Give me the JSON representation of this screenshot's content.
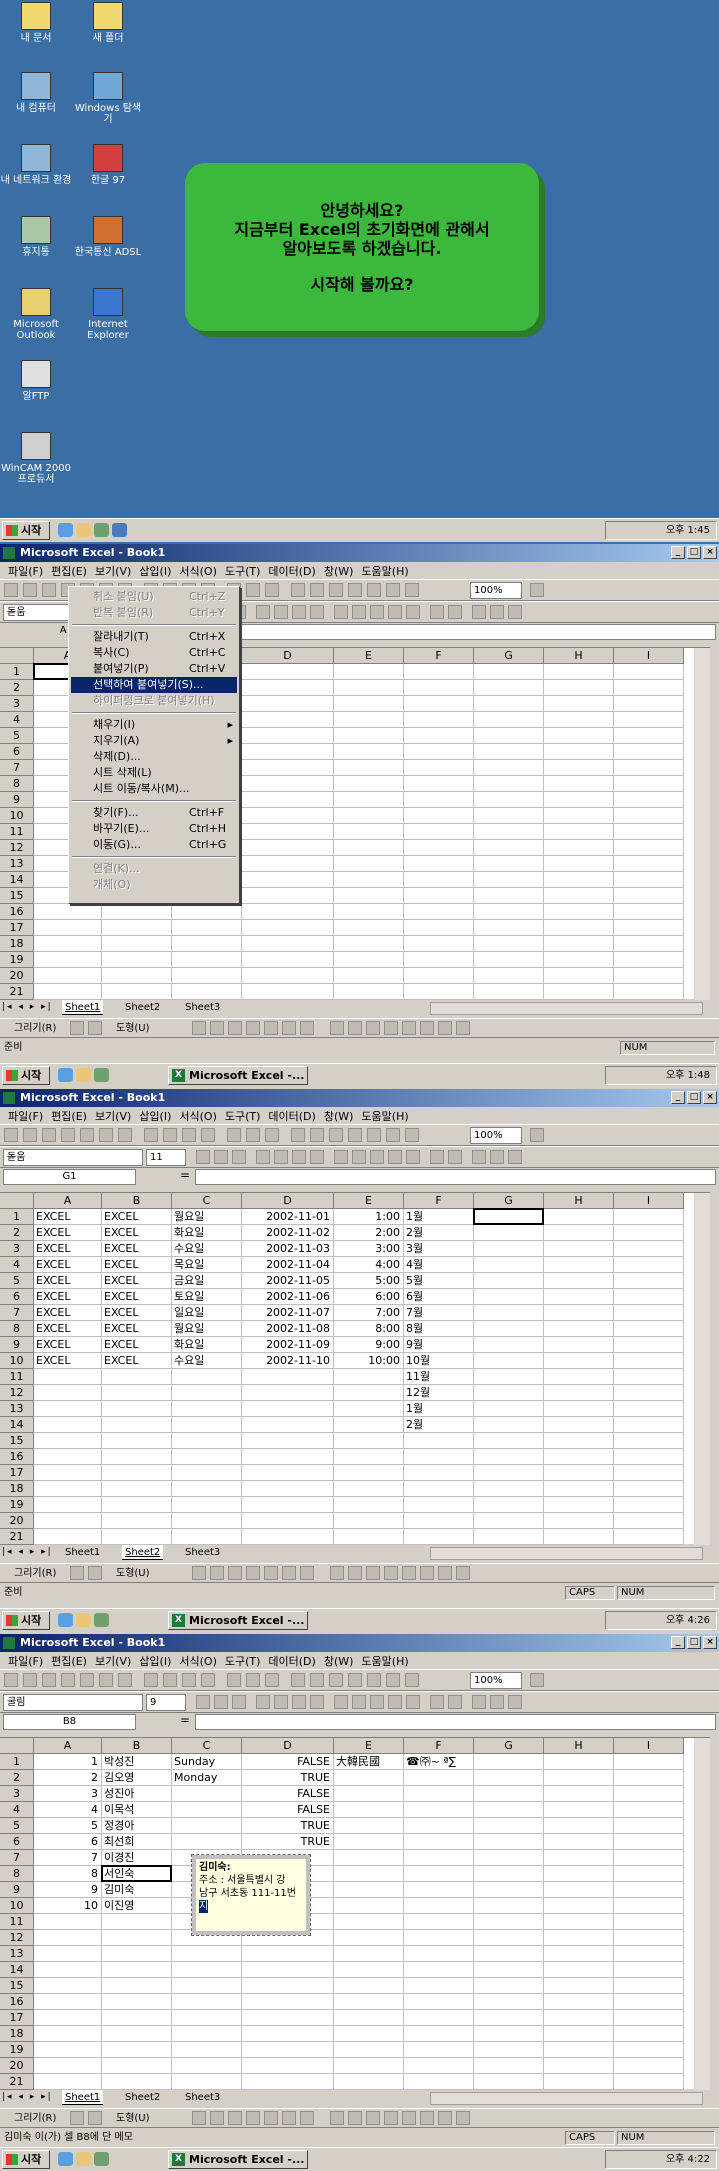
{
  "desktop": {
    "icons": [
      {
        "label": "내 문서",
        "icon": "folder-docs-icon"
      },
      {
        "label": "새 폴더",
        "icon": "folder-icon"
      },
      {
        "label": "내 컴퓨터",
        "icon": "computer-icon"
      },
      {
        "label": "Windows 탐색기",
        "icon": "explorer-icon"
      },
      {
        "label": "내 네트워크 환경",
        "icon": "network-icon"
      },
      {
        "label": "한글 97",
        "icon": "hangul-icon"
      },
      {
        "label": "휴지통",
        "icon": "recycle-bin-icon"
      },
      {
        "label": "한국통신 ADSL",
        "icon": "adsl-icon"
      },
      {
        "label": "Microsoft Outlook",
        "icon": "outlook-icon"
      },
      {
        "label": "Internet Explorer",
        "icon": "ie-icon"
      },
      {
        "label": "알FTP",
        "icon": "ftp-icon"
      },
      {
        "label": "WinCAM 2000 프로듀서",
        "icon": "wincam-icon"
      }
    ],
    "message": {
      "line1": "안녕하세요?",
      "line2": "지금부터 Excel의 초기화면에 관해서",
      "line3": "알아보도록 하겠습니다.",
      "line4": "시작해 볼까요?"
    },
    "clock": "오후 1:45"
  },
  "taskbar": {
    "start": "시작",
    "app_button": "Microsoft Excel -...",
    "clocks": [
      "오후 1:45",
      "오후 1:48",
      "오후 4:26",
      "오후 4:22"
    ]
  },
  "excel": {
    "title": "Microsoft Excel - Book1",
    "menu": [
      "파일(F)",
      "편집(E)",
      "보기(V)",
      "삽입(I)",
      "서식(O)",
      "도구(T)",
      "데이터(D)",
      "창(W)",
      "도움말(H)"
    ],
    "zoom": "100%",
    "font_name": "돋움",
    "font_size": "11",
    "font_name2": "굴림",
    "font_size2": "9",
    "columns": [
      "A",
      "B",
      "C",
      "D",
      "E",
      "F",
      "G",
      "H",
      "I"
    ],
    "sheets": [
      "Sheet1",
      "Sheet2",
      "Sheet3"
    ],
    "drawbar": {
      "draw": "그리기(R)",
      "autoshape": "도형(U)"
    },
    "status": {
      "ready": "준비",
      "num": "NUM",
      "caps": "CAPS",
      "comment_status": "김미숙 이(가) 셀 B8에 단 메모"
    }
  },
  "edit_menu": {
    "items": [
      {
        "label": "취소 붙임(U)",
        "shortcut": "Ctrl+Z",
        "state": "disabled"
      },
      {
        "label": "반복 붙임(R)",
        "shortcut": "Ctrl+Y",
        "state": "disabled"
      },
      {
        "label": "잘라내기(T)",
        "shortcut": "Ctrl+X",
        "state": "normal"
      },
      {
        "label": "복사(C)",
        "shortcut": "Ctrl+C",
        "state": "normal"
      },
      {
        "label": "붙여넣기(P)",
        "shortcut": "Ctrl+V",
        "state": "normal"
      },
      {
        "label": "선택하여 붙여넣기(S)...",
        "shortcut": "",
        "state": "highlight"
      },
      {
        "label": "하이퍼링크로 붙여넣기(H)",
        "shortcut": "",
        "state": "disabled"
      },
      {
        "label": "채우기(I)",
        "shortcut": "",
        "state": "sub"
      },
      {
        "label": "지우기(A)",
        "shortcut": "",
        "state": "sub"
      },
      {
        "label": "삭제(D)...",
        "shortcut": "",
        "state": "normal"
      },
      {
        "label": "시트 삭제(L)",
        "shortcut": "",
        "state": "normal"
      },
      {
        "label": "시트 이동/복사(M)...",
        "shortcut": "",
        "state": "normal"
      },
      {
        "label": "찾기(F)...",
        "shortcut": "Ctrl+F",
        "state": "normal"
      },
      {
        "label": "바꾸기(E)...",
        "shortcut": "Ctrl+H",
        "state": "normal"
      },
      {
        "label": "이동(G)...",
        "shortcut": "Ctrl+G",
        "state": "normal"
      },
      {
        "label": "연결(K)...",
        "shortcut": "",
        "state": "disabled"
      },
      {
        "label": "개체(O)",
        "shortcut": "",
        "state": "disabled"
      }
    ]
  },
  "screen2": {
    "namebox": "A1"
  },
  "screen3": {
    "namebox": "G1",
    "rows": [
      [
        "EXCEL",
        "EXCEL",
        "월요일",
        "2002-11-01",
        "1:00",
        "1월"
      ],
      [
        "EXCEL",
        "EXCEL",
        "화요일",
        "2002-11-02",
        "2:00",
        "2월"
      ],
      [
        "EXCEL",
        "EXCEL",
        "수요일",
        "2002-11-03",
        "3:00",
        "3월"
      ],
      [
        "EXCEL",
        "EXCEL",
        "목요일",
        "2002-11-04",
        "4:00",
        "4월"
      ],
      [
        "EXCEL",
        "EXCEL",
        "금요일",
        "2002-11-05",
        "5:00",
        "5월"
      ],
      [
        "EXCEL",
        "EXCEL",
        "토요일",
        "2002-11-06",
        "6:00",
        "6월"
      ],
      [
        "EXCEL",
        "EXCEL",
        "일요일",
        "2002-11-07",
        "7:00",
        "7월"
      ],
      [
        "EXCEL",
        "EXCEL",
        "월요일",
        "2002-11-08",
        "8:00",
        "8월"
      ],
      [
        "EXCEL",
        "EXCEL",
        "화요일",
        "2002-11-09",
        "9:00",
        "9월"
      ],
      [
        "EXCEL",
        "EXCEL",
        "수요일",
        "2002-11-10",
        "10:00",
        "10월"
      ],
      [
        "",
        "",
        "",
        "",
        "",
        "11월"
      ],
      [
        "",
        "",
        "",
        "",
        "",
        "12월"
      ],
      [
        "",
        "",
        "",
        "",
        "",
        "1월"
      ],
      [
        "",
        "",
        "",
        "",
        "",
        "2월"
      ]
    ]
  },
  "screen4": {
    "namebox": "B8",
    "rows": [
      [
        "1",
        "박성진",
        "Sunday",
        "FALSE",
        "大韓民國",
        "☎㈜~ ª∑"
      ],
      [
        "2",
        "김오영",
        "Monday",
        "TRUE",
        "",
        ""
      ],
      [
        "3",
        "성진아",
        "",
        "FALSE",
        "",
        ""
      ],
      [
        "4",
        "이목석",
        "",
        "FALSE",
        "",
        ""
      ],
      [
        "5",
        "정경아",
        "",
        "TRUE",
        "",
        ""
      ],
      [
        "6",
        "최선희",
        "",
        "TRUE",
        "",
        ""
      ],
      [
        "7",
        "이경진",
        "",
        "",
        "",
        ""
      ],
      [
        "8",
        "서인숙",
        "",
        "",
        "",
        ""
      ],
      [
        "9",
        "김미숙",
        "",
        "",
        "",
        ""
      ],
      [
        "10",
        "이진영",
        "",
        "",
        "",
        ""
      ]
    ],
    "comment": {
      "author": "김미숙:",
      "line1": "주소 : 서울특별시 강",
      "line2": "남구 서초동 111-11번",
      "line3": "지"
    }
  }
}
